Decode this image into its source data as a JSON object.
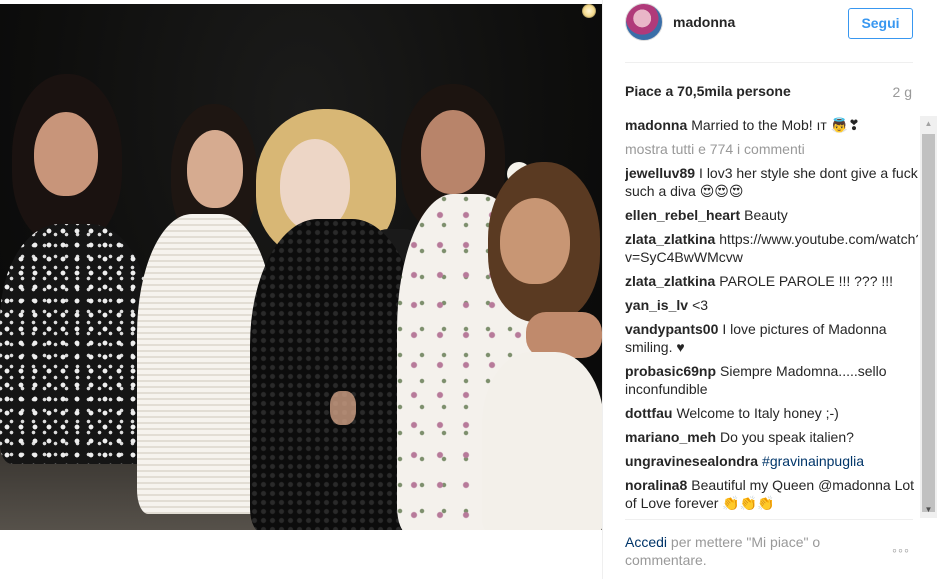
{
  "post": {
    "username": "madonna",
    "follow_label": "Segui",
    "likes": "Piace a 70,5mila persone",
    "time": "2 g"
  },
  "comments": {
    "caption": {
      "user": "madonna",
      "text": "Married to the Mob! ıт 👼❣"
    },
    "load_more": "mostra tutti e 774 i commenti",
    "items": [
      {
        "user": "jewelluv89",
        "text": "I lov3 her style she dont give a fuck such a diva 😍😍😍"
      },
      {
        "user": "ellen_rebel_heart",
        "text": "Beauty"
      },
      {
        "user": "zlata_zlatkina",
        "text": "https://www.youtube.com/watch?v=SyC4BwWMcvw"
      },
      {
        "user": "zlata_zlatkina",
        "text": "PAROLE PAROLE !!! ??? !!!"
      },
      {
        "user": "yan_is_lv",
        "text": "<3"
      },
      {
        "user": "vandypants00",
        "text": "I love pictures of Madonna smiling. ♥"
      },
      {
        "user": "probasic69np",
        "text": "Siempre Madomna.....sello inconfundible"
      },
      {
        "user": "dottfau",
        "text": "Welcome to Italy honey ;-)"
      },
      {
        "user": "mariano_meh",
        "text": "Do you speak italien?"
      },
      {
        "user": "ungravinesealondra",
        "text": "#gravinainpuglia"
      },
      {
        "user": "noralina8",
        "text": "Beautiful my Queen @madonna Lot of Love forever 👏👏👏"
      }
    ]
  },
  "footer": {
    "login_link": "Accedi",
    "login_text": " per mettere \"Mi piace\" o commentare.",
    "more_icon": "◦◦◦"
  },
  "colors": {
    "follow_blue": "#3897f0",
    "link_navy": "#003569",
    "muted_gray": "#999999"
  }
}
